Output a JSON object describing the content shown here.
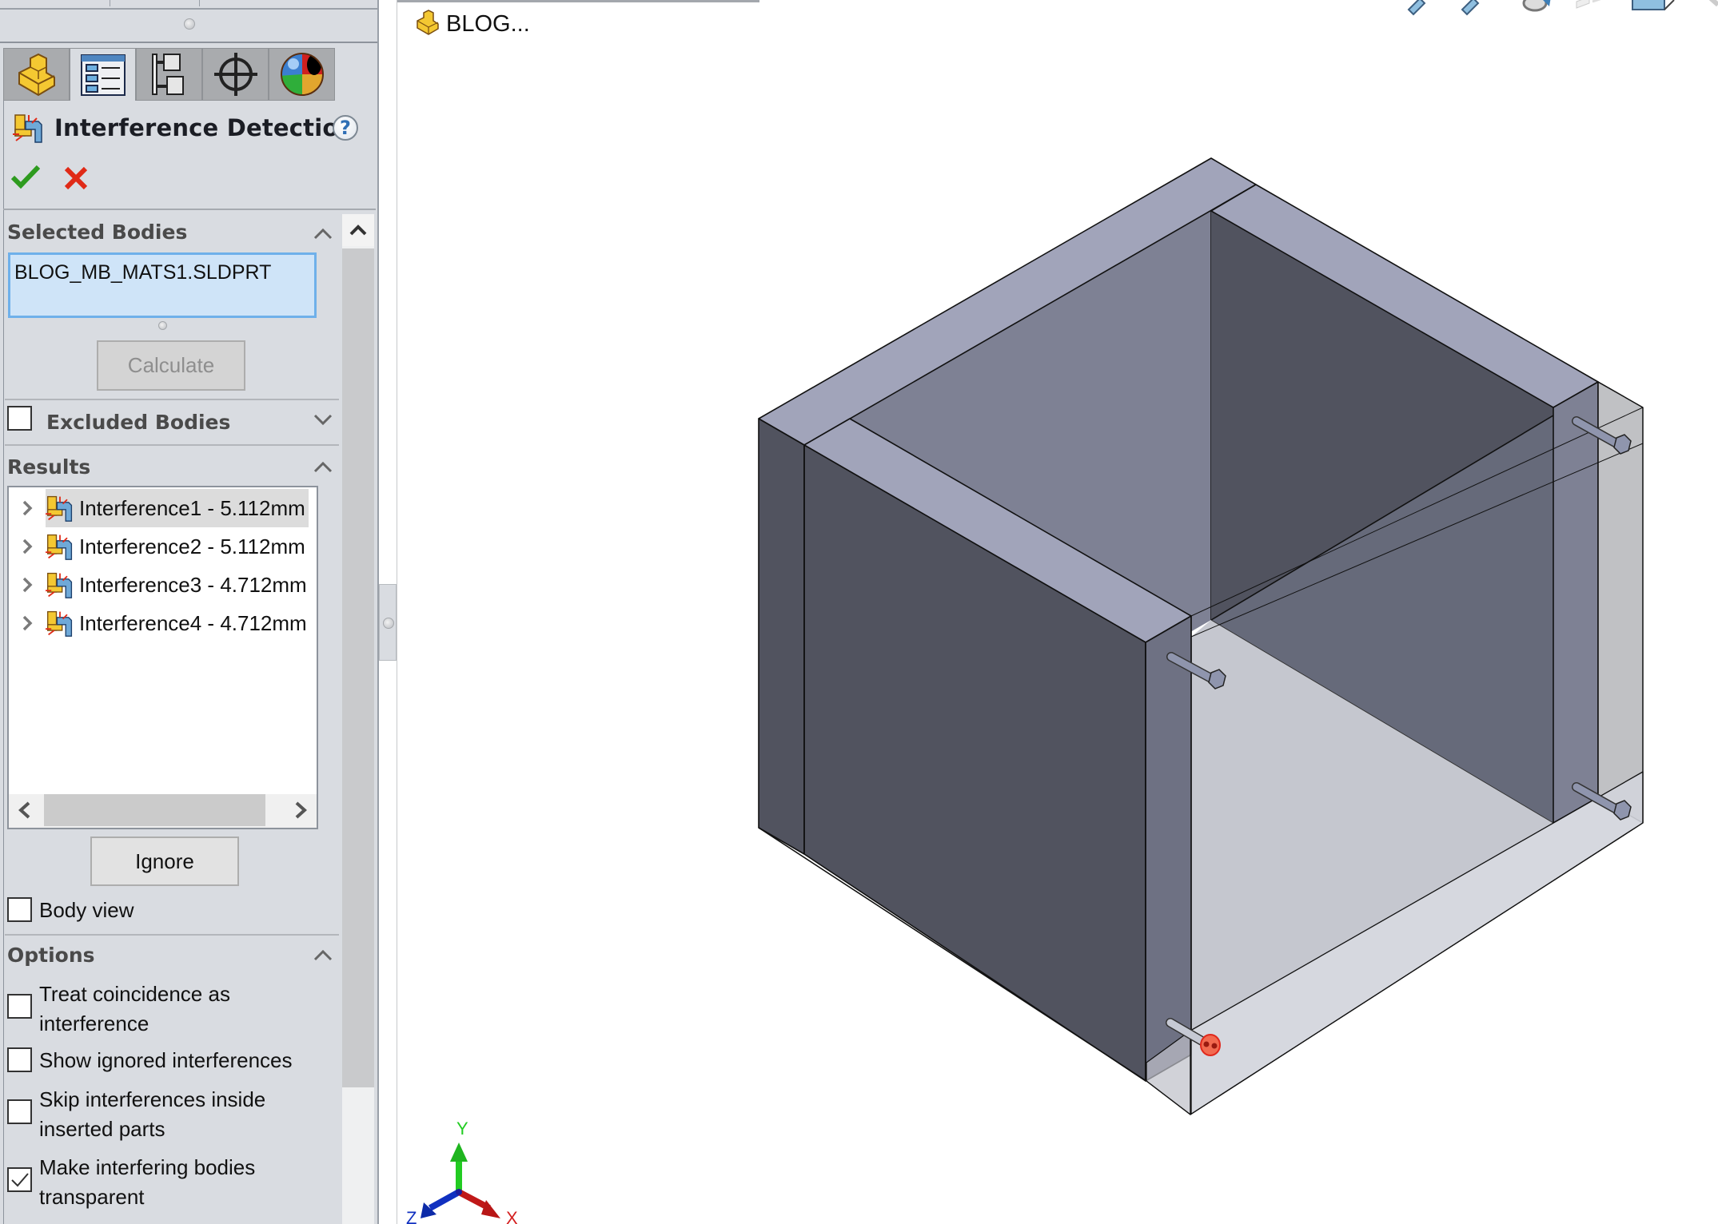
{
  "feature_tree": {
    "root_label": "BLOG...",
    "root_icon": "part-icon"
  },
  "panel_tabs": [
    {
      "name": "featuremanager",
      "icon": "part-icon"
    },
    {
      "name": "propertymanager",
      "icon": "property-list-icon",
      "active": true
    },
    {
      "name": "configurationmanager",
      "icon": "configuration-tree-icon"
    },
    {
      "name": "dimxpertmanager",
      "icon": "crosshair-icon"
    },
    {
      "name": "displaymanager",
      "icon": "appearance-sphere-icon"
    }
  ],
  "property_manager": {
    "title": "Interference Detection",
    "help_label": "?",
    "ok_icon": "checkmark-icon",
    "cancel_icon": "close-icon",
    "selected_bodies": {
      "header": "Selected Bodies",
      "items": [
        "BLOG_MB_MATS1.SLDPRT"
      ],
      "calculate_label": "Calculate"
    },
    "excluded_bodies": {
      "header": "Excluded Bodies",
      "checked": false
    },
    "results": {
      "header": "Results",
      "items": [
        {
          "label": "Interference1 - 5.112mm",
          "selected": true
        },
        {
          "label": "Interference2 - 5.112mm",
          "selected": false
        },
        {
          "label": "Interference3 - 4.712mm",
          "selected": false
        },
        {
          "label": "Interference4 - 4.712mm",
          "selected": false
        }
      ],
      "ignore_label": "Ignore",
      "body_view_label": "Body view",
      "body_view_checked": false
    },
    "options": {
      "header": "Options",
      "items": [
        {
          "label_line1": "Treat coincidence as",
          "label_line2": "interference",
          "checked": false
        },
        {
          "label_line1": "Show ignored interferences",
          "label_line2": "",
          "checked": false
        },
        {
          "label_line1": "Skip interferences inside",
          "label_line2": "inserted parts",
          "checked": false
        },
        {
          "label_line1": "Make interfering bodies",
          "label_line2": "transparent",
          "checked": true
        }
      ]
    }
  },
  "triad": {
    "x": "X",
    "y": "Y",
    "z": "Z"
  },
  "colors": {
    "panel_bg": "#d9dce1",
    "selection_box": "#cfe4f8",
    "ok_green": "#2e9b1f",
    "cancel_red": "#e02a17",
    "interference_red": "#f05a3c",
    "axis_x": "#d42020",
    "axis_y": "#22cc22",
    "axis_z": "#1030c0"
  }
}
